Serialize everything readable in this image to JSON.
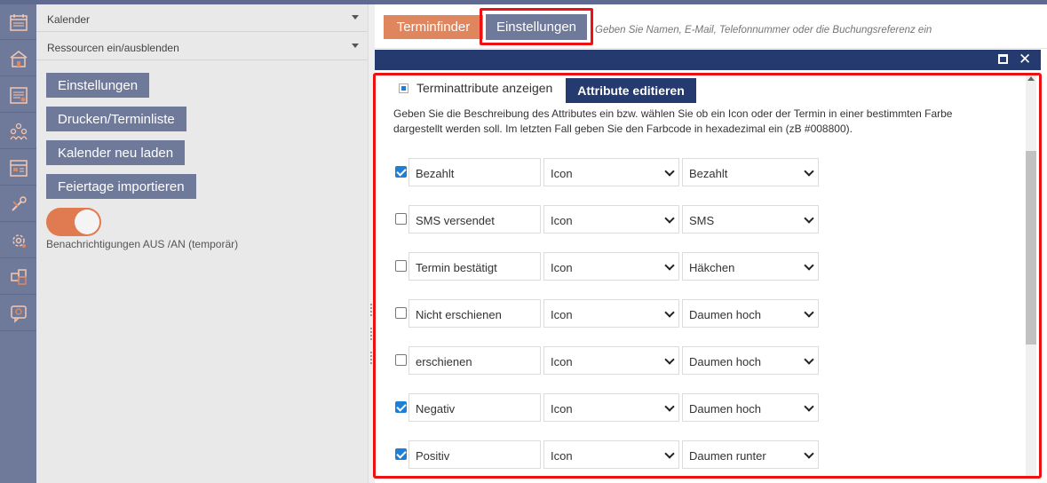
{
  "left_panel": {
    "accordion": [
      {
        "label": "Kalender"
      },
      {
        "label": "Ressourcen ein/ausblenden"
      }
    ],
    "buttons": [
      {
        "label": "Einstellungen"
      },
      {
        "label": "Drucken/Terminliste"
      },
      {
        "label": "Kalender neu laden"
      },
      {
        "label": "Feiertage importieren"
      }
    ],
    "notifications_toggle": {
      "state": "on",
      "label": "Benachrichtigungen AUS /AN (temporär)"
    }
  },
  "icon_rail": [
    "calendar-icon",
    "building-icon",
    "calendar-list-icon",
    "people-icon",
    "calendar-grid-icon",
    "tools-icon",
    "settings-gear-icon",
    "puzzle-icon",
    "support-chat-icon"
  ],
  "toolbar": {
    "terminfinder_label": "Terminfinder",
    "einstellungen_label": "Einstellungen",
    "search_placeholder": "Geben Sie Namen, E-Mail, Telefonnummer oder die Buchungsreferenz ein"
  },
  "dialog": {
    "show_attributes_label": "Terminattribute anzeigen",
    "edit_attributes_button": "Attribute editieren",
    "description": "Geben Sie die Beschreibung des Attributes ein bzw. wählen Sie ob ein Icon oder der Termin in einer bestimmten Farbe dargestellt werden soll. Im letzten Fall geben Sie den Farbcode in hexadezimal ein (zB #008800).",
    "attributes": [
      {
        "checked": true,
        "name": "Bezahlt",
        "type": "Icon",
        "value": "Bezahlt"
      },
      {
        "checked": false,
        "name": "SMS versendet",
        "type": "Icon",
        "value": "SMS"
      },
      {
        "checked": false,
        "name": "Termin bestätigt",
        "type": "Icon",
        "value": "Häkchen"
      },
      {
        "checked": false,
        "name": "Nicht erschienen",
        "type": "Icon",
        "value": "Daumen hoch"
      },
      {
        "checked": false,
        "name": "erschienen",
        "type": "Icon",
        "value": "Daumen hoch"
      },
      {
        "checked": true,
        "name": "Negativ",
        "type": "Icon",
        "value": "Daumen hoch"
      },
      {
        "checked": true,
        "name": "Positiv",
        "type": "Icon",
        "value": "Daumen runter"
      }
    ]
  },
  "colors": {
    "sidebar": "#6f7a9b",
    "accent_orange": "#e0865e",
    "dialog_header": "#253a6e",
    "highlight": "#ee1111",
    "checkbox_blue": "#1e7fd6"
  }
}
